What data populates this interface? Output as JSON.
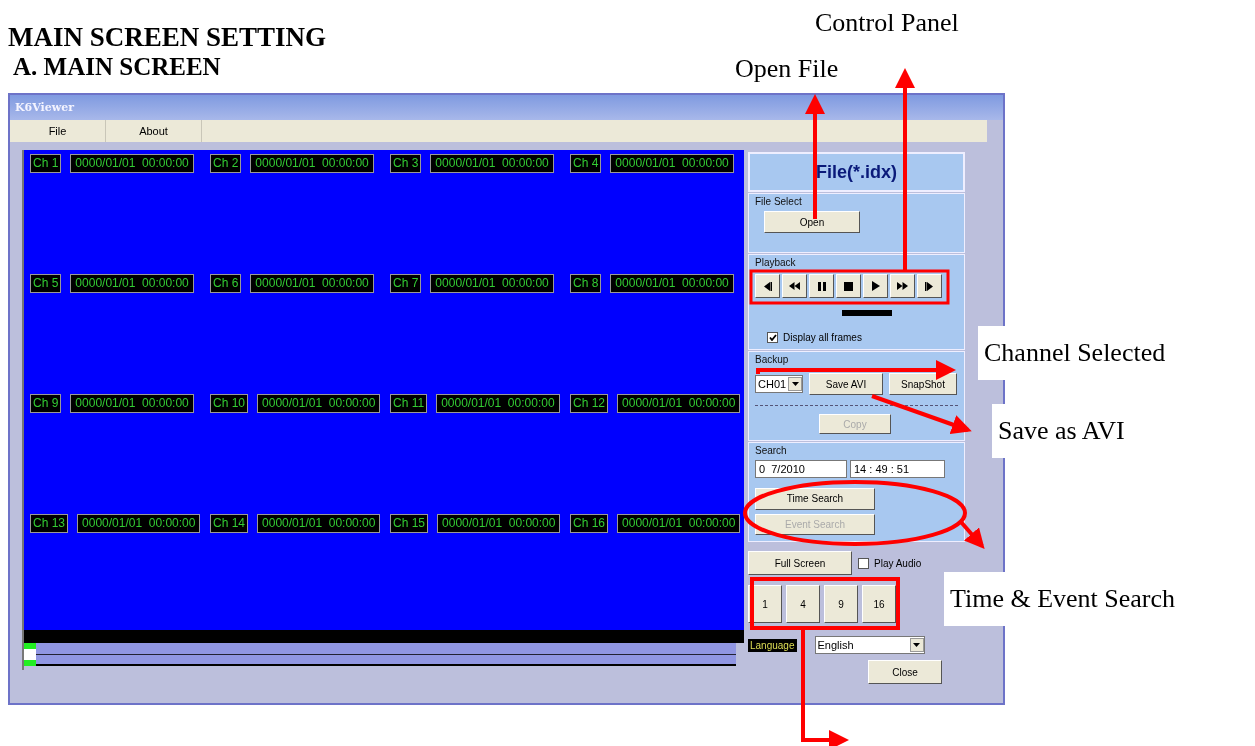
{
  "page": {
    "heading": "MAIN SCREEN SETTING",
    "subheading": "A. MAIN SCREEN"
  },
  "window": {
    "title": "K6Viewer",
    "menu": [
      "File",
      "About"
    ],
    "channels": [
      {
        "label": "Ch 1",
        "timestamp": "0000/01/01  00:00:00"
      },
      {
        "label": "Ch 2",
        "timestamp": "0000/01/01  00:00:00"
      },
      {
        "label": "Ch 3",
        "timestamp": "0000/01/01  00:00:00"
      },
      {
        "label": "Ch 4",
        "timestamp": "0000/01/01  00:00:00"
      },
      {
        "label": "Ch 5",
        "timestamp": "0000/01/01  00:00:00"
      },
      {
        "label": "Ch 6",
        "timestamp": "0000/01/01  00:00:00"
      },
      {
        "label": "Ch 7",
        "timestamp": "0000/01/01  00:00:00"
      },
      {
        "label": "Ch 8",
        "timestamp": "0000/01/01  00:00:00"
      },
      {
        "label": "Ch 9",
        "timestamp": "0000/01/01  00:00:00"
      },
      {
        "label": "Ch 10",
        "timestamp": "0000/01/01  00:00:00"
      },
      {
        "label": "Ch 11",
        "timestamp": "0000/01/01  00:00:00"
      },
      {
        "label": "Ch 12",
        "timestamp": "0000/01/01  00:00:00"
      },
      {
        "label": "Ch 13",
        "timestamp": "0000/01/01  00:00:00"
      },
      {
        "label": "Ch 14",
        "timestamp": "0000/01/01  00:00:00"
      },
      {
        "label": "Ch 15",
        "timestamp": "0000/01/01  00:00:00"
      },
      {
        "label": "Ch 16",
        "timestamp": "0000/01/01  00:00:00"
      }
    ],
    "seek": {
      "level": 0.0
    }
  },
  "panel": {
    "file_title": "File(*.idx)",
    "file_select": {
      "legend": "File Select",
      "button": "Open"
    },
    "playback": {
      "legend": "Playback",
      "buttons": [
        {
          "kind": "prev-frame"
        },
        {
          "kind": "rewind"
        },
        {
          "kind": "pause"
        },
        {
          "kind": "stop"
        },
        {
          "kind": "play"
        },
        {
          "kind": "fast-forward"
        },
        {
          "kind": "next-frame"
        }
      ]
    },
    "display_all_frames": {
      "label": "Display all frames",
      "checked": true
    },
    "backup": {
      "legend": "Backup",
      "channel": "CH01",
      "save_avi": "Save AVI",
      "snapshot": "SnapShot",
      "copy": {
        "label": "Copy",
        "disabled": true
      }
    },
    "search": {
      "legend": "Search",
      "date": "0  7/2010",
      "time": "14 : 49 : 51",
      "time_search": {
        "label": "Time Search",
        "disabled": false
      },
      "event_search": {
        "label": "Event Search",
        "disabled": true
      }
    },
    "full_screen": "Full Screen",
    "play_audio": {
      "label": "Play Audio",
      "checked": false
    },
    "layouts": [
      "1",
      "4",
      "9",
      "16"
    ],
    "language": {
      "label": "Language",
      "value": "English"
    },
    "close": "Close"
  },
  "annotations": [
    {
      "text": "Control Panel",
      "boxed": false
    },
    {
      "text": "Open File",
      "boxed": false
    },
    {
      "text": "Channel Selected",
      "boxed": true
    },
    {
      "text": "Save as AVI",
      "boxed": true
    },
    {
      "text": "Time & Event Search",
      "boxed": true
    }
  ]
}
